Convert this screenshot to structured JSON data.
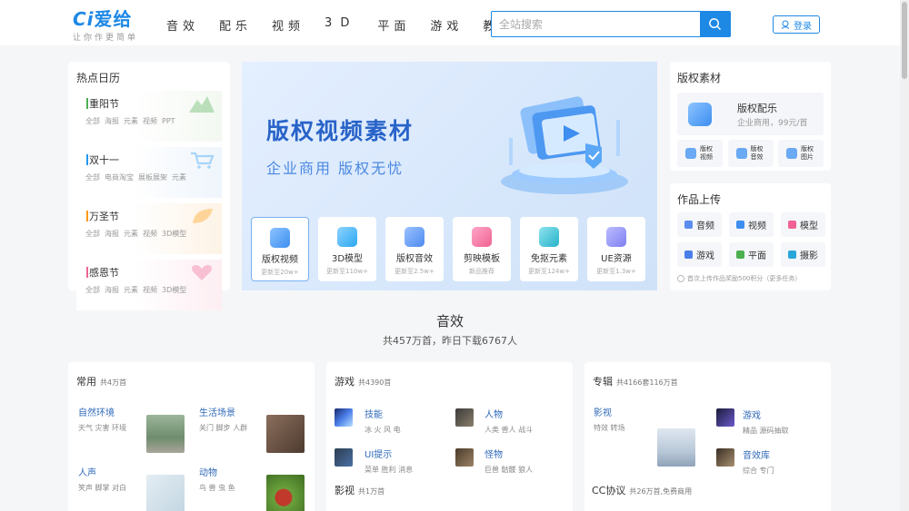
{
  "header": {
    "logo_text": "爱给",
    "logo_mark": "Ci",
    "slogan": "让你作更简单",
    "nav": [
      "音效",
      "配乐",
      "视频",
      "3D",
      "平面",
      "游戏",
      "教程"
    ],
    "search_placeholder": "全站搜索",
    "login_label": "登录"
  },
  "calendar": {
    "title": "热点日历",
    "items": [
      {
        "name": "重阳节",
        "tags": [
          "全部",
          "海报",
          "元素",
          "视频",
          "PPT"
        ],
        "color": "#4caf50"
      },
      {
        "name": "双十一",
        "tags": [
          "全部",
          "电商淘宝",
          "展板展架",
          "元素"
        ],
        "color": "#2196f3"
      },
      {
        "name": "万圣节",
        "tags": [
          "全部",
          "海报",
          "元素",
          "视频",
          "3D模型"
        ],
        "color": "#ff9800"
      },
      {
        "name": "感恩节",
        "tags": [
          "全部",
          "海报",
          "元素",
          "视频",
          "3D模型"
        ],
        "color": "#f06292"
      }
    ]
  },
  "banner": {
    "title": "版权视频素材",
    "subtitle": "企业商用  版权无忧",
    "categories": [
      {
        "label": "版权视频",
        "sub": "更新至20w+",
        "color": "#3d8ef0"
      },
      {
        "label": "3D模型",
        "sub": "更新至110w+",
        "color": "#2aa7f0"
      },
      {
        "label": "版权音效",
        "sub": "更新至2.5w+",
        "color": "#4c8af0"
      },
      {
        "label": "剪映模板",
        "sub": "新品推荐",
        "color": "#f06292"
      },
      {
        "label": "免抠元素",
        "sub": "更新至124w+",
        "color": "#26b3c9"
      },
      {
        "label": "UE资源",
        "sub": "更新至1.3w+",
        "color": "#7e7ff0"
      }
    ]
  },
  "copyright": {
    "title": "版权素材",
    "main_title": "版权配乐",
    "main_sub": "企业商用，99元/首",
    "minis": [
      "版权视频",
      "版权音效",
      "版权图片"
    ]
  },
  "upload": {
    "title": "作品上传",
    "items": [
      {
        "label": "音频",
        "color": "#5b8def"
      },
      {
        "label": "视频",
        "color": "#3d8ef0"
      },
      {
        "label": "模型",
        "color": "#f06292"
      },
      {
        "label": "游戏",
        "color": "#4a7ee8"
      },
      {
        "label": "平面",
        "color": "#4caf50"
      },
      {
        "label": "摄影",
        "color": "#26a6d9"
      }
    ],
    "note": "首次上传作品奖励500积分（更多任务）"
  },
  "section": {
    "title": "音效",
    "subtitle": "共457万首，昨日下载6767人"
  },
  "card_common": {
    "title": "常用",
    "count": "共4万首",
    "blocks": [
      {
        "title": "自然环境",
        "sub": "天气 灾害 环境"
      },
      {
        "title": "生活场景",
        "sub": "关门 脚步 人群"
      },
      {
        "title": "人声",
        "sub": "笑声 脚掌 对白"
      },
      {
        "title": "动物",
        "sub": "鸟 兽 虫 鱼"
      }
    ]
  },
  "card_game": {
    "title": "游戏",
    "count": "共4390首",
    "blocks": [
      {
        "title": "技能",
        "sub": "冰 火 风 电"
      },
      {
        "title": "人物",
        "sub": "人类 兽人 战斗"
      },
      {
        "title": "UI提示",
        "sub": "菜单 胜利 消息"
      },
      {
        "title": "怪物",
        "sub": "巨兽 骷髅 狼人"
      }
    ],
    "sub_title": "影视",
    "sub_count": "共1万首"
  },
  "card_album": {
    "title": "专辑",
    "count": "共4166套116万首",
    "blocks": [
      {
        "title": "影视",
        "sub": "特效 转场"
      },
      {
        "title": "游戏",
        "sub": "精品 源码抽取"
      },
      {
        "title": "音效库",
        "sub": "综合 专门"
      }
    ],
    "sub_title": "CC协议",
    "sub_count": "共26万首,免费商用"
  }
}
